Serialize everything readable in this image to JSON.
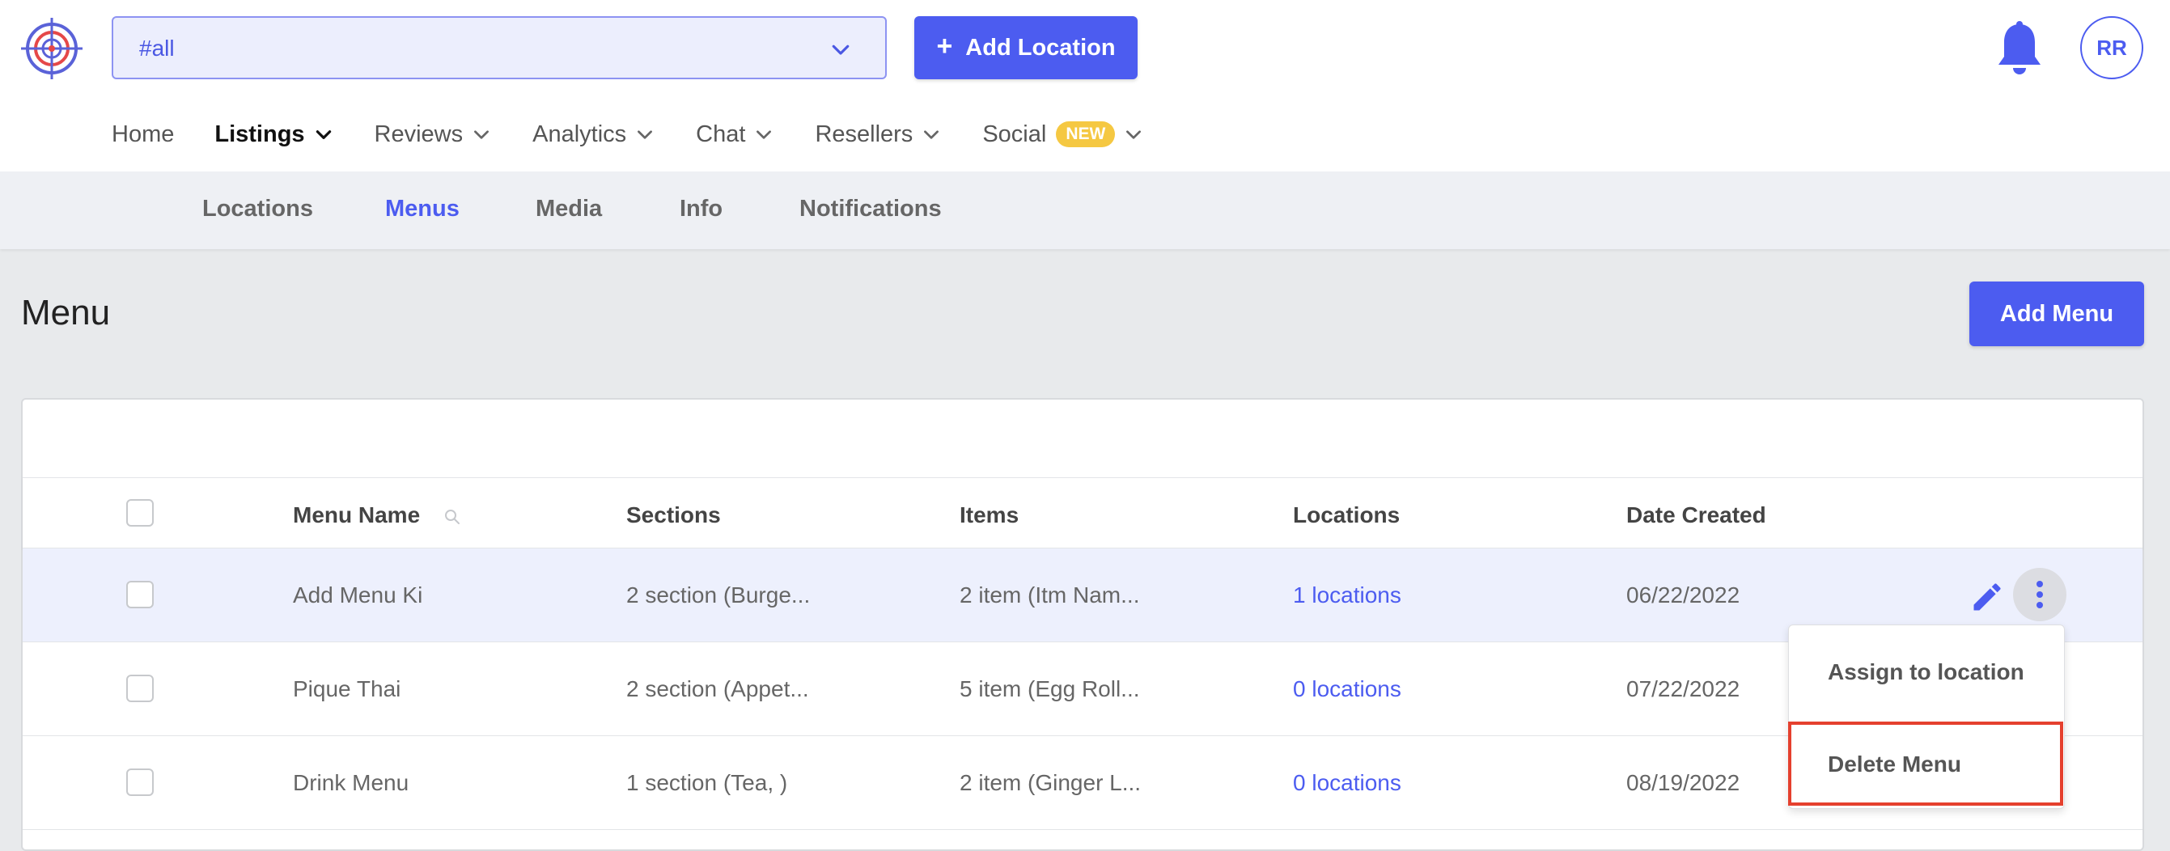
{
  "header": {
    "location_filter": {
      "value": "#all"
    },
    "add_location_label": "Add Location",
    "user_initials": "RR"
  },
  "main_nav": {
    "items": [
      {
        "label": "Home",
        "has_dropdown": false,
        "active": false
      },
      {
        "label": "Listings",
        "has_dropdown": true,
        "active": true
      },
      {
        "label": "Reviews",
        "has_dropdown": true,
        "active": false
      },
      {
        "label": "Analytics",
        "has_dropdown": true,
        "active": false
      },
      {
        "label": "Chat",
        "has_dropdown": true,
        "active": false
      },
      {
        "label": "Resellers",
        "has_dropdown": true,
        "active": false
      },
      {
        "label": "Social",
        "has_dropdown": true,
        "active": false,
        "badge": "NEW"
      }
    ]
  },
  "sub_nav": {
    "tabs": [
      {
        "label": "Locations",
        "active": false
      },
      {
        "label": "Menus",
        "active": true
      },
      {
        "label": "Media",
        "active": false
      },
      {
        "label": "Info",
        "active": false
      },
      {
        "label": "Notifications",
        "active": false
      }
    ]
  },
  "page": {
    "title": "Menu",
    "add_menu_label": "Add Menu"
  },
  "table": {
    "columns": [
      "Menu Name",
      "Sections",
      "Items",
      "Locations",
      "Date Created"
    ],
    "rows": [
      {
        "name": "Add Menu Ki",
        "sections": "2 section (Burge...",
        "items": "2 item (Itm Nam...",
        "locations": "1 locations",
        "date": "06/22/2022",
        "selected": true
      },
      {
        "name": "Pique Thai",
        "sections": "2 section (Appet...",
        "items": "5 item (Egg Roll...",
        "locations": "0 locations",
        "date": "07/22/2022",
        "selected": false
      },
      {
        "name": "Drink Menu",
        "sections": "1 section (Tea, )",
        "items": "2 item (Ginger L...",
        "locations": "0 locations",
        "date": "08/19/2022",
        "selected": false
      }
    ]
  },
  "row_menu": {
    "options": [
      "Assign to location",
      "Delete Menu"
    ],
    "highlighted": "Delete Menu"
  },
  "colors": {
    "accent": "#4c5cf0",
    "badge": "#f5c842",
    "highlight_border": "#e5402e"
  },
  "icons": [
    "target-logo-icon",
    "chevron-down-icon",
    "plus-icon",
    "bell-icon",
    "search-icon",
    "pencil-icon",
    "more-vertical-icon"
  ]
}
